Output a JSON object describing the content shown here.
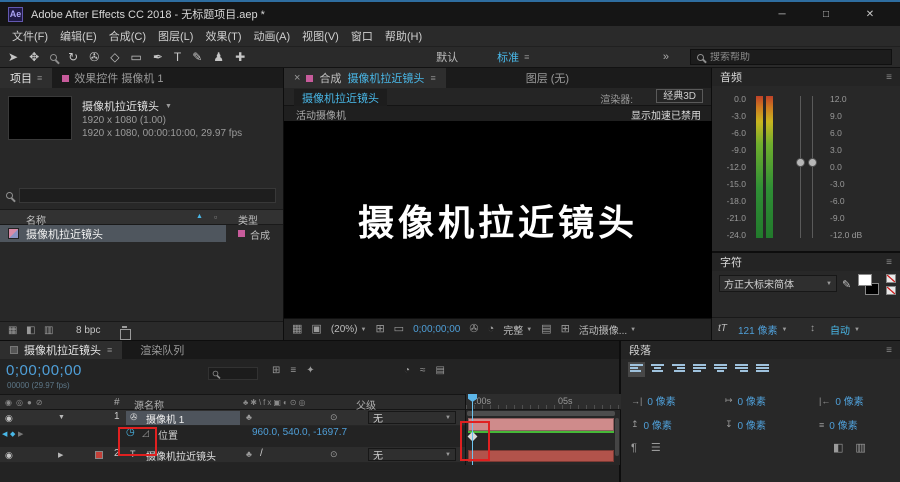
{
  "titlebar": {
    "app_icon": "Ae",
    "title": "Adobe After Effects CC 2018 - 无标题项目.aep *"
  },
  "window_controls": {
    "minimize": "─",
    "maximize": "□",
    "close": "✕"
  },
  "menubar": {
    "items": [
      "文件(F)",
      "编辑(E)",
      "合成(C)",
      "图层(L)",
      "效果(T)",
      "动画(A)",
      "视图(V)",
      "窗口",
      "帮助(H)"
    ]
  },
  "toolbar": {
    "tools": [
      "➤",
      "✥",
      "↻",
      "✇",
      "◇",
      "▭",
      "✒",
      "T",
      "✎",
      "♟",
      "✚"
    ],
    "workspace_default": "默认",
    "workspace_active": "标准",
    "overflow": "»",
    "search_placeholder": "搜索帮助"
  },
  "icons": {
    "menu": "≡",
    "dd": "▼",
    "sort": "▲",
    "xtab": "×",
    "eye": "◉",
    "twirl_open": "▼",
    "twirl_closed": "▶",
    "stopwatch": "◷",
    "graph": "◿",
    "nav_prev": "◀",
    "nav_next": "▶",
    "nav_kf": "◆",
    "cam": "✇",
    "tlayer": "T",
    "quality": "/",
    "collapse": "♣",
    "threed": "⊙",
    "grid": "▦",
    "half": "◧",
    "rows": "▥",
    "monitor": "▣",
    "safe": "⊞",
    "region": "▭",
    "clock": "◔",
    "wave": "≈",
    "sheet": "▤",
    "star": "✦",
    "eq": "≡",
    "pil": "¶",
    "bars": "☰",
    "pen": "✎",
    "leading": "↕",
    "flagbox": "▫"
  },
  "project": {
    "tab_project": "项目",
    "tab_effects": "效果控件 摄像机 1",
    "comp_name": "摄像机拉近镜头",
    "info1": "1920 x 1080 (1.00)",
    "info2": "1920 x 1080, 00:00:10:00, 29.97 fps",
    "col_name": "名称",
    "col_type": "类型",
    "item_name": "摄像机拉近镜头",
    "item_type": "合成",
    "bpc": "8 bpc"
  },
  "comp": {
    "tab_prefix": "合成",
    "tab_name": "摄像机拉近镜头",
    "tab_layer": "图层 (无)",
    "viewer_tab": "摄像机拉近镜头",
    "renderer_label": "渲染器:",
    "renderer_value": "经典3D",
    "view_label": "活动摄像机",
    "gpu_notice": "显示加速已禁用",
    "canvas_text": "摄像机拉近镜头",
    "zoom": "(20%)",
    "timecode": "0;00;00;00",
    "resolution": "完整",
    "camera_select": "活动摄像..."
  },
  "audio": {
    "title": "音频",
    "left_scale": [
      "0.0",
      "-3.0",
      "-6.0",
      "-9.0",
      "-12.0",
      "-15.0",
      "-18.0",
      "-21.0",
      "-24.0"
    ],
    "right_scale": [
      "12.0",
      "9.0",
      "6.0",
      "3.0",
      "0.0",
      "-3.0",
      "-6.0",
      "-9.0",
      "-12.0 dB"
    ]
  },
  "character": {
    "title": "字符",
    "font": "方正大标宋简体",
    "size_icon": "tT",
    "size_value": "121 像素",
    "auto_label": "自动"
  },
  "paragraph": {
    "title": "段落",
    "field_icons": [
      "→|",
      "|←",
      "↦",
      "↥",
      "↧",
      "≡"
    ],
    "fields": [
      "0 像素",
      "0 像素",
      "0 像素",
      "0 像素",
      "0 像素",
      "0 像素"
    ]
  },
  "timeline": {
    "tab_comp": "摄像机拉近镜头",
    "tab_queue": "渲染队列",
    "timecode": "0;00;00;00",
    "frame_info": "00000 (29.97 fps)",
    "av_icons": "◉◎●⊘",
    "col_index": "#",
    "col_source": "源名称",
    "switch_icons": "♣✱\\fx▣◐⊙◎",
    "col_parent": "父级",
    "ruler_start": ":00s",
    "ruler_mid": "05s",
    "layers": [
      {
        "index": "1",
        "name": "摄像机 1",
        "parent": "无"
      },
      {
        "index": "2",
        "name": "摄像机拉近镜头",
        "parent": "无"
      }
    ],
    "property": {
      "name": "位置",
      "value": "960.0, 540.0, -1697.7"
    }
  }
}
